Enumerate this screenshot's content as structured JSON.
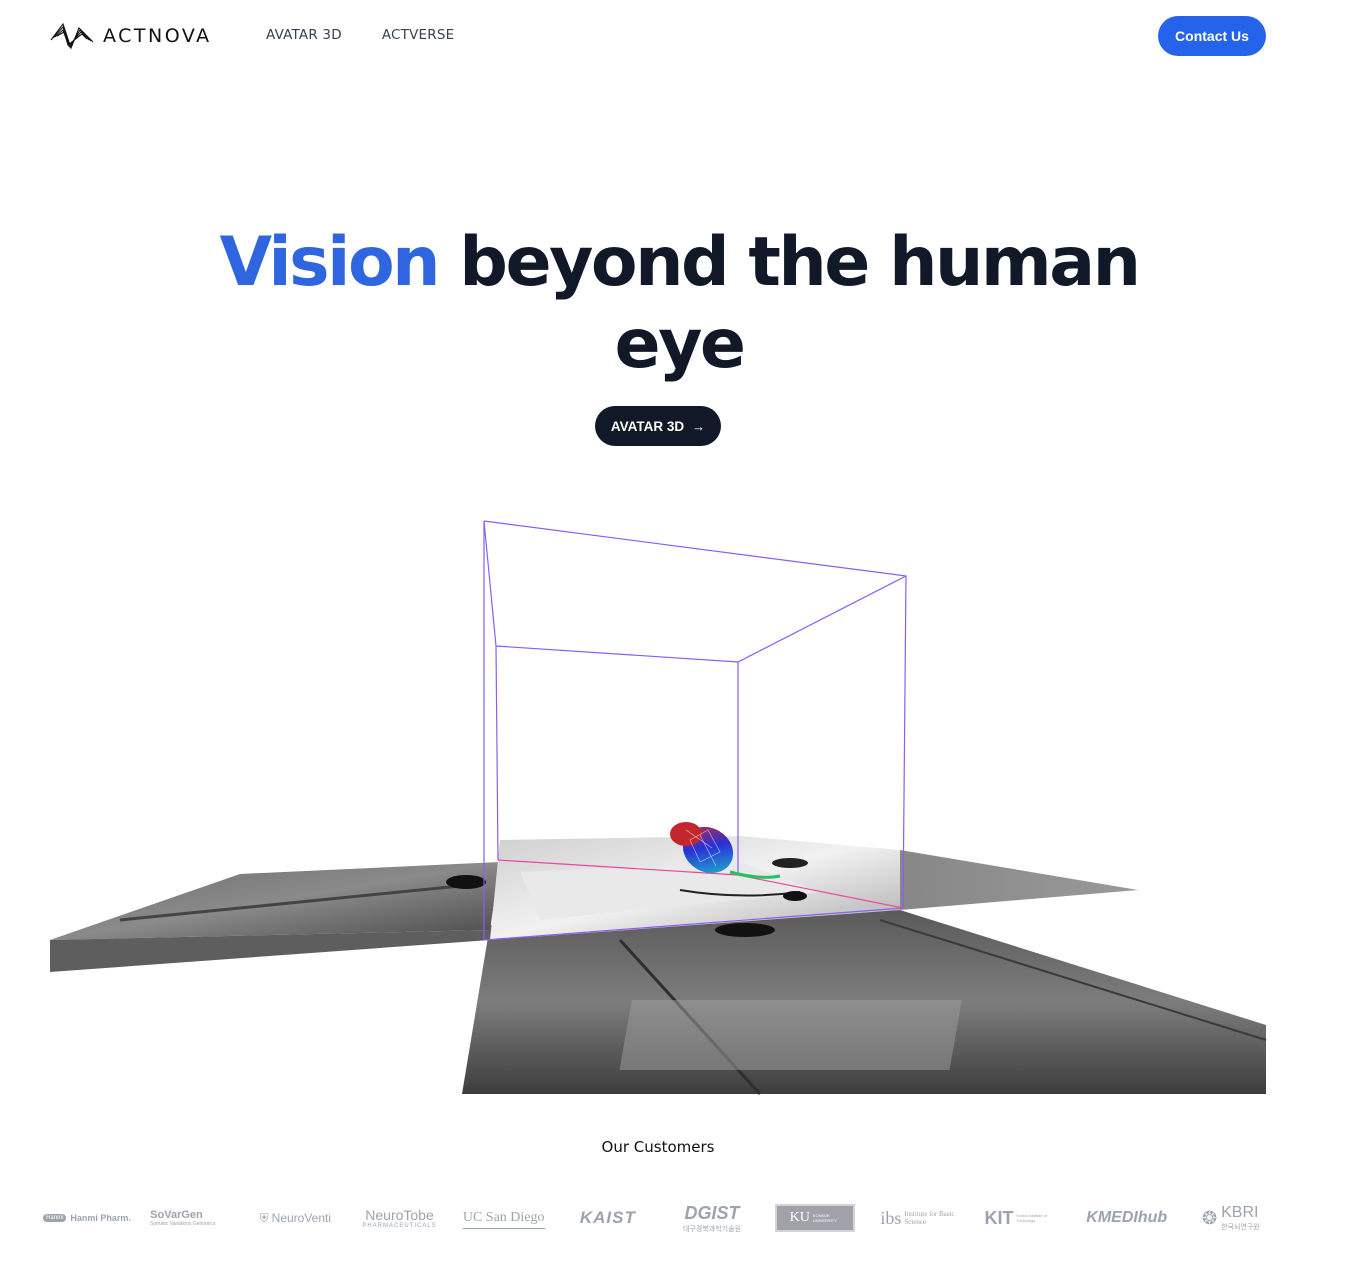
{
  "header": {
    "brand": "ACTNOVA",
    "nav": [
      {
        "label": "AVATAR 3D"
      },
      {
        "label": "ACTVERSE"
      }
    ],
    "contact_label": "Contact Us"
  },
  "hero": {
    "title_accent": "Vision",
    "title_rest": " beyond the human eye",
    "cta_label": "AVATAR 3D",
    "cta_icon": "arrow-right-icon"
  },
  "customers": {
    "title": "Our Customers",
    "logos": [
      {
        "name": "Hanmi Pharm.",
        "badge": "Hanmi"
      },
      {
        "name": "SoVarGen",
        "sub": "Somatic Variations Genomics"
      },
      {
        "name": "NeuroVenti"
      },
      {
        "name": "NeuroTobe",
        "sub": "PHARMACEUTICALS"
      },
      {
        "name": "UC San Diego"
      },
      {
        "name": "KAIST"
      },
      {
        "name": "DGIST",
        "sub": "대구경북과학기술원"
      },
      {
        "name": "KU",
        "sub": "KONKUK UNIVERSITY"
      },
      {
        "name": "ibs",
        "sub": "Institute for Basic Science"
      },
      {
        "name": "KIT",
        "sub": "Korea Institute of Toxicology"
      },
      {
        "name": "KMEDIhub"
      },
      {
        "name": "KBRI",
        "sub": "한국뇌연구원"
      }
    ]
  },
  "colors": {
    "accent": "#2f66e0",
    "contact_button": "#2563eb",
    "dark": "#111827",
    "box_lines": "#8b5cf6"
  }
}
